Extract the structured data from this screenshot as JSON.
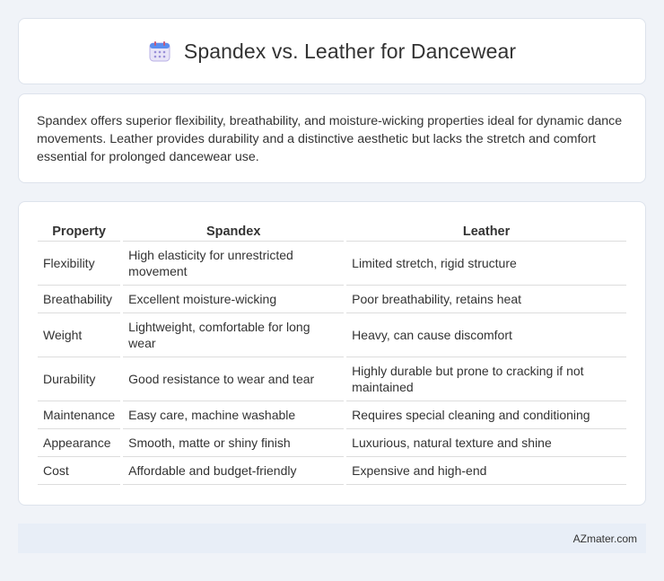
{
  "header": {
    "title": "Spandex vs. Leather for Dancewear",
    "icon": "calendar-icon"
  },
  "intro": {
    "text": "Spandex offers superior flexibility, breathability, and moisture-wicking properties ideal for dynamic dance movements. Leather provides durability and a distinctive aesthetic but lacks the stretch and comfort essential for prolonged dancewear use."
  },
  "table": {
    "headers": [
      "Property",
      "Spandex",
      "Leather"
    ],
    "rows": [
      [
        "Flexibility",
        "High elasticity for unrestricted movement",
        "Limited stretch, rigid structure"
      ],
      [
        "Breathability",
        "Excellent moisture-wicking",
        "Poor breathability, retains heat"
      ],
      [
        "Weight",
        "Lightweight, comfortable for long wear",
        "Heavy, can cause discomfort"
      ],
      [
        "Durability",
        "Good resistance to wear and tear",
        "Highly durable but prone to cracking if not maintained"
      ],
      [
        "Maintenance",
        "Easy care, machine washable",
        "Requires special cleaning and conditioning"
      ],
      [
        "Appearance",
        "Smooth, matte or shiny finish",
        "Luxurious, natural texture and shine"
      ],
      [
        "Cost",
        "Affordable and budget-friendly",
        "Expensive and high-end"
      ]
    ]
  },
  "footer": {
    "brand": "AZmater.com"
  }
}
